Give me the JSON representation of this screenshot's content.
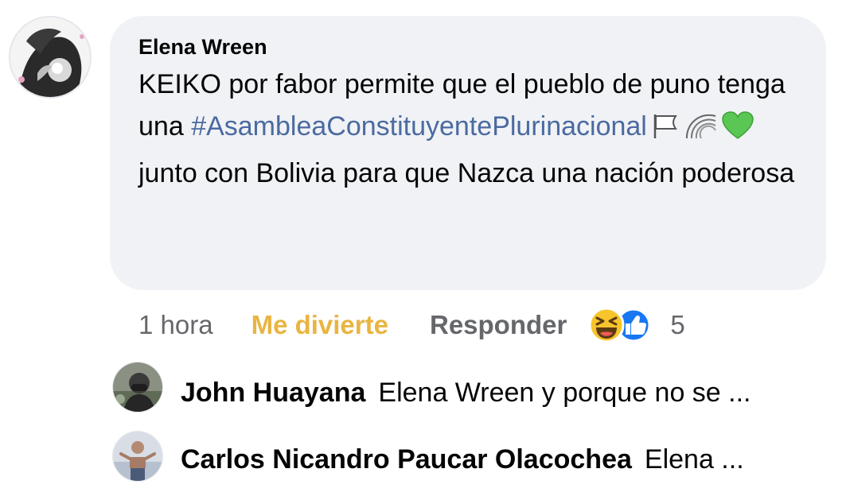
{
  "comment": {
    "author": "Elena Wreen",
    "text_before": "KEIKO por fabor permite que el pueblo de puno tenga una",
    "hashtag": "#AsambleaConstituyentePlurinacional",
    "text_after": "junto con Bolivia para que Nazca una nación poderosa",
    "emojis": [
      "white-flag-icon",
      "rainbow-icon",
      "green-heart-icon"
    ]
  },
  "actions": {
    "time": "1 hora",
    "reaction_label": "Me divierte",
    "reply_label": "Responder",
    "reaction_icons": [
      "haha-emoji-icon",
      "like-icon"
    ],
    "reaction_count": "5"
  },
  "replies": [
    {
      "name": "John Huayana",
      "text": "Elena Wreen y porque no se ..."
    },
    {
      "name": "Carlos Nicandro Paucar Olacochea",
      "text": "Elena ..."
    }
  ],
  "colors": {
    "bubble_bg": "#f0f2f5",
    "hashtag": "#4b6aa0",
    "reaction_active": "#e9b541",
    "secondary_text": "#65676b",
    "like_blue": "#1877f2"
  }
}
